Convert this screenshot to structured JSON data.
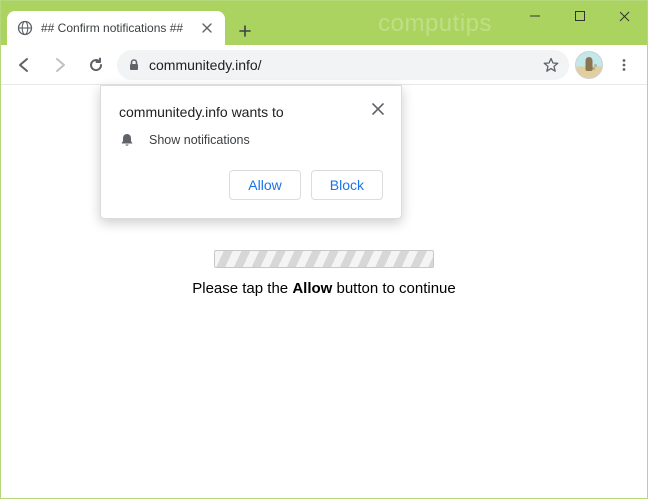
{
  "window": {
    "minimize": "minimize-icon",
    "maximize": "maximize-icon",
    "close": "close-icon"
  },
  "tab": {
    "title": "## Confirm notifications ##"
  },
  "watermark": "computips",
  "omnibox": {
    "url": "communitedy.info/"
  },
  "permission": {
    "title": "communitedy.info wants to",
    "entry": "Show notifications",
    "allow": "Allow",
    "block": "Block"
  },
  "page": {
    "msg_pre": "Please tap the ",
    "msg_bold": "Allow",
    "msg_post": " button to continue"
  }
}
